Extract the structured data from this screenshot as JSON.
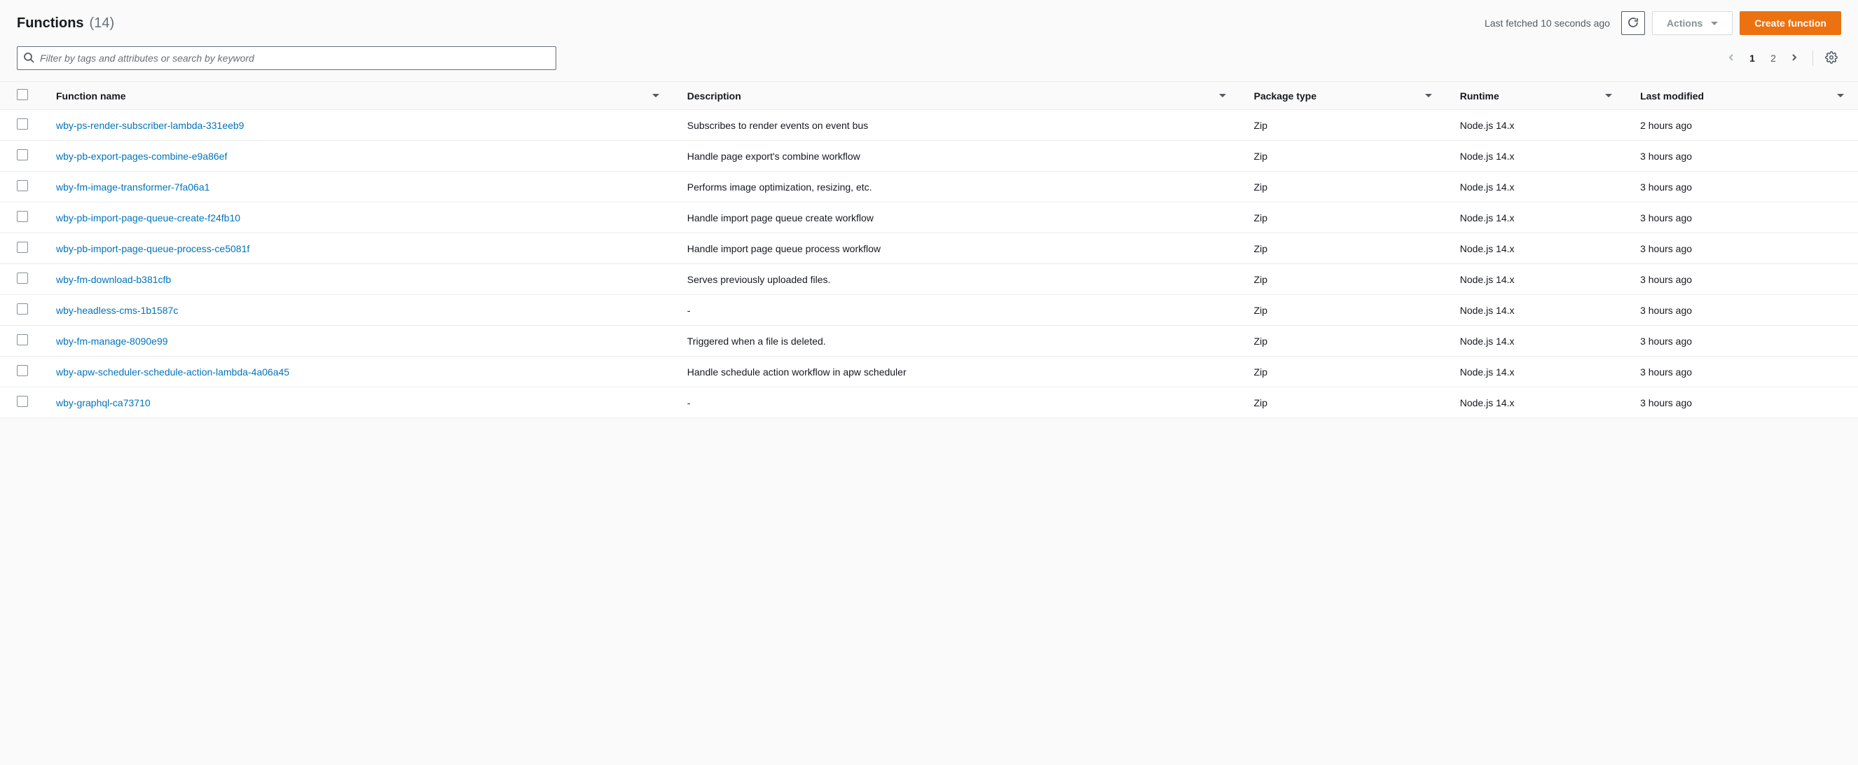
{
  "header": {
    "title": "Functions",
    "count": "(14)",
    "last_fetched": "Last fetched 10 seconds ago",
    "actions_label": "Actions",
    "create_label": "Create function"
  },
  "search": {
    "placeholder": "Filter by tags and attributes or search by keyword"
  },
  "pagination": {
    "pages": [
      "1",
      "2"
    ],
    "current": "1"
  },
  "columns": {
    "name": "Function name",
    "description": "Description",
    "package_type": "Package type",
    "runtime": "Runtime",
    "last_modified": "Last modified"
  },
  "rows": [
    {
      "name": "wby-ps-render-subscriber-lambda-331eeb9",
      "description": "Subscribes to render events on event bus",
      "package_type": "Zip",
      "runtime": "Node.js 14.x",
      "last_modified": "2 hours ago"
    },
    {
      "name": "wby-pb-export-pages-combine-e9a86ef",
      "description": "Handle page export's combine workflow",
      "package_type": "Zip",
      "runtime": "Node.js 14.x",
      "last_modified": "3 hours ago"
    },
    {
      "name": "wby-fm-image-transformer-7fa06a1",
      "description": "Performs image optimization, resizing, etc.",
      "package_type": "Zip",
      "runtime": "Node.js 14.x",
      "last_modified": "3 hours ago"
    },
    {
      "name": "wby-pb-import-page-queue-create-f24fb10",
      "description": "Handle import page queue create workflow",
      "package_type": "Zip",
      "runtime": "Node.js 14.x",
      "last_modified": "3 hours ago"
    },
    {
      "name": "wby-pb-import-page-queue-process-ce5081f",
      "description": "Handle import page queue process workflow",
      "package_type": "Zip",
      "runtime": "Node.js 14.x",
      "last_modified": "3 hours ago"
    },
    {
      "name": "wby-fm-download-b381cfb",
      "description": "Serves previously uploaded files.",
      "package_type": "Zip",
      "runtime": "Node.js 14.x",
      "last_modified": "3 hours ago"
    },
    {
      "name": "wby-headless-cms-1b1587c",
      "description": "-",
      "package_type": "Zip",
      "runtime": "Node.js 14.x",
      "last_modified": "3 hours ago"
    },
    {
      "name": "wby-fm-manage-8090e99",
      "description": "Triggered when a file is deleted.",
      "package_type": "Zip",
      "runtime": "Node.js 14.x",
      "last_modified": "3 hours ago"
    },
    {
      "name": "wby-apw-scheduler-schedule-action-lambda-4a06a45",
      "description": "Handle schedule action workflow in apw scheduler",
      "package_type": "Zip",
      "runtime": "Node.js 14.x",
      "last_modified": "3 hours ago"
    },
    {
      "name": "wby-graphql-ca73710",
      "description": "-",
      "package_type": "Zip",
      "runtime": "Node.js 14.x",
      "last_modified": "3 hours ago"
    }
  ]
}
